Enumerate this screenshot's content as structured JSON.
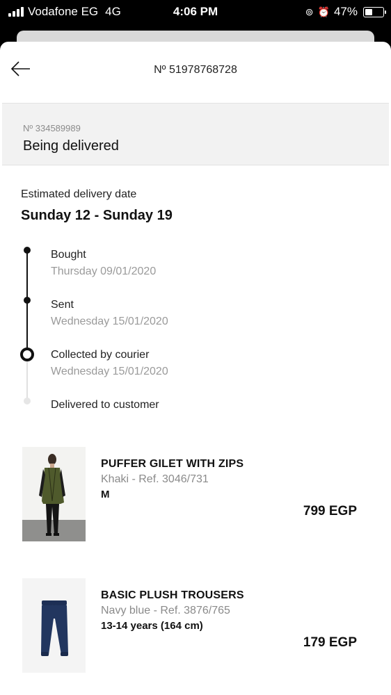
{
  "status_bar": {
    "carrier": "Vodafone EG",
    "network": "4G",
    "time": "4:06 PM",
    "battery": "47%",
    "battery_level": 0.47
  },
  "header": {
    "back_icon": "arrow-left-icon",
    "title": "Nº 51978768728"
  },
  "order_status": {
    "number": "Nº 334589989",
    "text": "Being delivered"
  },
  "delivery": {
    "label": "Estimated delivery date",
    "date": "Sunday 12 - Sunday 19"
  },
  "timeline": [
    {
      "label": "Bought",
      "date": "Thursday 09/01/2020",
      "state": "done"
    },
    {
      "label": "Sent",
      "date": "Wednesday 15/01/2020",
      "state": "done"
    },
    {
      "label": "Collected by courier",
      "date": "Wednesday 15/01/2020",
      "state": "current"
    },
    {
      "label": "Delivered to customer",
      "date": "",
      "state": "pending"
    }
  ],
  "products": [
    {
      "name": "PUFFER GILET WITH ZIPS",
      "ref": "Khaki - Ref. 3046/731",
      "size": "M",
      "price": "799 EGP",
      "image_icon": "khaki-gilet-photo"
    },
    {
      "name": "BASIC PLUSH TROUSERS",
      "ref": "Navy blue - Ref. 3876/765",
      "size": "13-14 years (164 cm)",
      "price": "179 EGP",
      "image_icon": "navy-trousers-photo"
    }
  ],
  "colors": {
    "accent": "#111111",
    "muted": "#9a9a9a",
    "status_bg": "#f2f2f2"
  }
}
